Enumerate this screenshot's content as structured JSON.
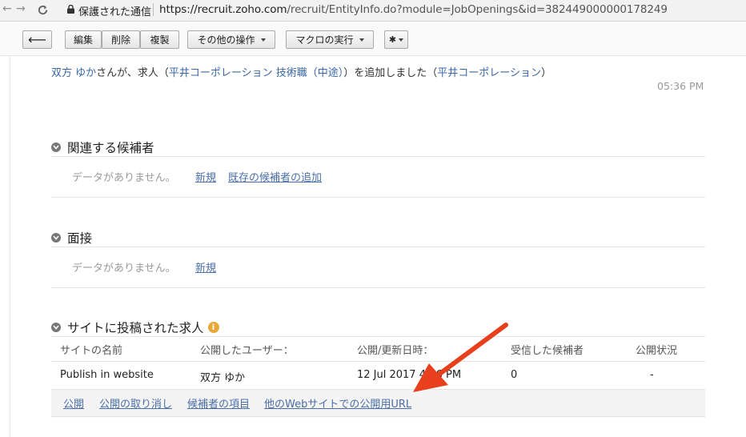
{
  "browser": {
    "secure_label": "保護された通信",
    "url_host": "https://recruit.zoho.com",
    "url_path": "/recruit/EntityInfo.do?module=JobOpenings&id=382449000000178249"
  },
  "toolbar": {
    "back_glyph": "⟵",
    "edit": "編集",
    "delete": "削除",
    "clone": "複製",
    "more_actions": "その他の操作",
    "run_macro": "マクロの実行",
    "gear_glyph": "✱"
  },
  "activity": {
    "user": "双方 ゆか",
    "text1": "さんが、求人（",
    "job_link": "平井コーポレーション 技術職（中途）",
    "text2": "）を追加しました（",
    "company_link": "平井コーポレーション",
    "text3": "）",
    "time": "05:36 PM"
  },
  "related_candidates": {
    "title": "関連する候補者",
    "empty": "データがありません。",
    "new_link": "新規",
    "add_existing_link": "既存の候補者の追加"
  },
  "interviews": {
    "title": "面接",
    "empty": "データがありません。",
    "new_link": "新規"
  },
  "published_jobs": {
    "title": "サイトに投稿された求人",
    "info_glyph": "i",
    "headers": [
      "サイトの名前",
      "公開したユーザー：",
      "公開/更新日時：",
      "受信した候補者",
      "公開状況"
    ],
    "row": {
      "site": "Publish in website",
      "user": "双方 ゆか",
      "date": "12 Jul 2017 4:56 PM",
      "received": "0",
      "status": "-"
    },
    "actions": [
      "公開",
      "公開の取り消し",
      "候補者の項目",
      "他のWebサイトでの公開用URL"
    ]
  },
  "annotation": {
    "arrow_color": "#e8401c"
  }
}
